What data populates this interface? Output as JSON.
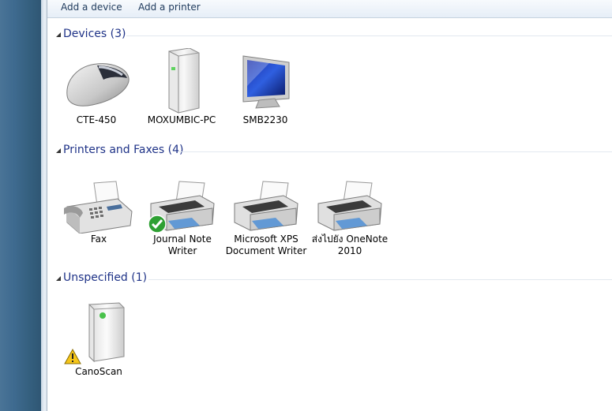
{
  "toolbar": {
    "add_device": "Add a device",
    "add_printer": "Add a printer"
  },
  "groups": {
    "devices": {
      "title": "Devices (3)",
      "items": [
        {
          "label": "CTE-450",
          "icon": "mouse-icon"
        },
        {
          "label": "MOXUMBIC-PC",
          "icon": "computer-tower-icon"
        },
        {
          "label": "SMB2230",
          "icon": "monitor-icon"
        }
      ]
    },
    "printers": {
      "title": "Printers and Faxes (4)",
      "items": [
        {
          "label": "Fax",
          "icon": "fax-icon"
        },
        {
          "label": "Journal Note Writer",
          "icon": "printer-icon",
          "badge": "default-check-icon"
        },
        {
          "label": "Microsoft XPS Document Writer",
          "icon": "printer-icon"
        },
        {
          "label": "ส่งไปยัง OneNote 2010",
          "icon": "printer-icon"
        }
      ]
    },
    "unspecified": {
      "title": "Unspecified (1)",
      "items": [
        {
          "label": "CanoScan",
          "icon": "scanner-device-icon",
          "badge": "warning-icon"
        }
      ]
    }
  },
  "colors": {
    "group_title": "#1e3287",
    "toolbar_text": "#1e395b",
    "desktop_blue": "#3e6a8f"
  }
}
